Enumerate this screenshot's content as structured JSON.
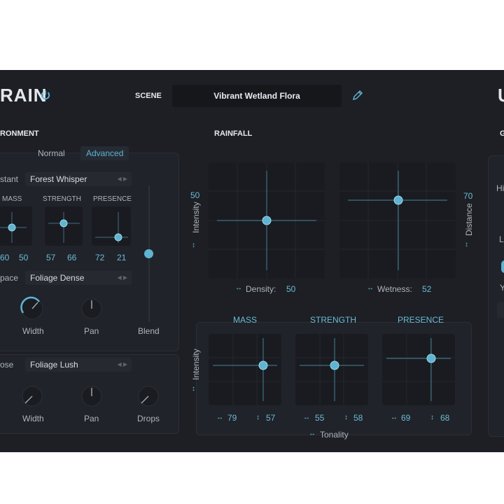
{
  "header": {
    "brand": "RAIN",
    "scene_label": "SCENE",
    "scene_name": "Vibrant Wetland Flora",
    "brand_right": "U"
  },
  "environment": {
    "title": "RONMENT",
    "tabs": [
      "Normal",
      "Advanced"
    ],
    "active_tab": "Advanced",
    "distant": {
      "label": "stant",
      "preset": "Forest Whisper",
      "pads": [
        {
          "label": "MASS",
          "v1": "60",
          "v2": "50"
        },
        {
          "label": "STRENGTH",
          "v1": "57",
          "v2": "66"
        },
        {
          "label": "PRESENCE",
          "v1": "72",
          "v2": "21"
        }
      ]
    },
    "space": {
      "label": "pace",
      "preset": "Foliage Dense",
      "width_label": "Width",
      "pan_label": "Pan",
      "blend_label": "Blend"
    },
    "close": {
      "label": "ose",
      "preset": "Foliage Lush",
      "width_label": "Width",
      "pan_label": "Pan",
      "drops_label": "Drops"
    }
  },
  "rainfall": {
    "title": "RAINFALL",
    "intensity_label": "Intensity",
    "intensity_value": "50",
    "distance_label": "Distance",
    "distance_value": "70",
    "density_label": "Density:",
    "density_value": "50",
    "wetness_label": "Wetness:",
    "wetness_value": "52",
    "tone": {
      "headers": [
        "MASS",
        "STRENGTH",
        "PRESENCE"
      ],
      "values": [
        [
          "79",
          "57"
        ],
        [
          "55",
          "58"
        ],
        [
          "69",
          "68"
        ]
      ],
      "intensity_label": "Intensity",
      "tonality_label": "Tonality"
    }
  },
  "right_panel": {
    "title": "G",
    "labels": [
      "Hi",
      "L",
      "Y"
    ]
  },
  "colors": {
    "accent": "#5fb4d2",
    "background": "#1d1f24",
    "panel": "#202329",
    "pad": "#191b20"
  },
  "icons": {
    "power": "power-icon",
    "edit": "pencil-icon",
    "horizontal": "horizontal-arrows-icon",
    "vertical": "vertical-arrows-icon",
    "selector": "left-right-arrows-icon"
  }
}
